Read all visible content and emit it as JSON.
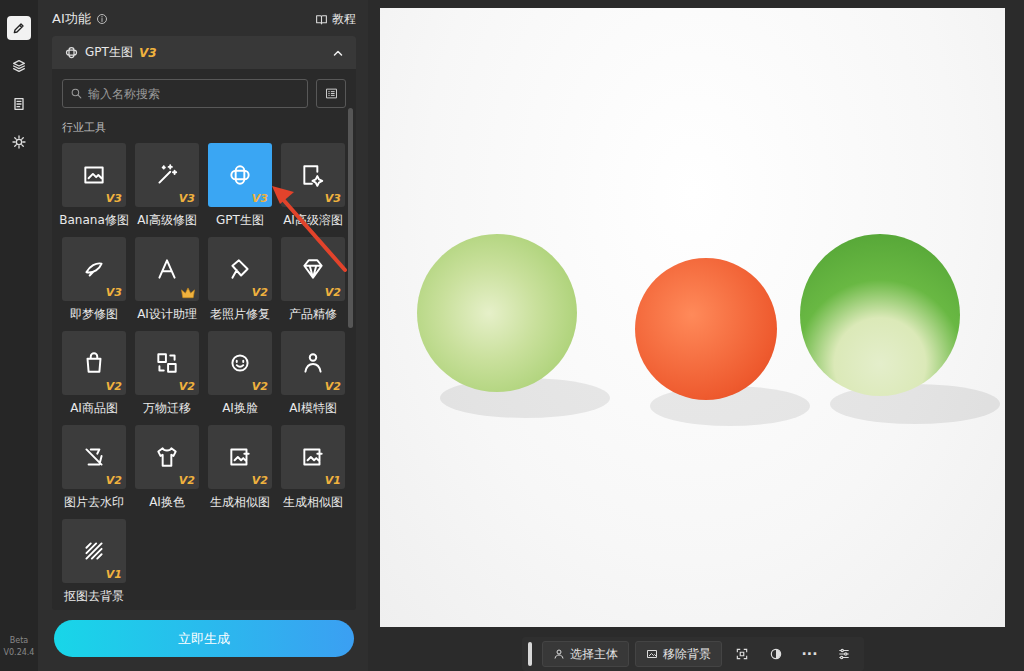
{
  "nav": [
    {
      "selected": true
    },
    {
      "selected": false
    },
    {
      "selected": false
    },
    {
      "selected": false
    }
  ],
  "version": {
    "label": "Beta",
    "number": "V0.24.4"
  },
  "panel": {
    "title": "AI功能",
    "tutorial": "教程"
  },
  "section": {
    "title": "GPT生图",
    "badge": "V3",
    "expanded": true
  },
  "search": {
    "placeholder": "输入名称搜索"
  },
  "group": "行业工具",
  "tools": [
    {
      "label": "Banana修图",
      "kind": "version",
      "badge": "V3",
      "selected": false
    },
    {
      "label": "AI高级修图",
      "kind": "version",
      "badge": "V3",
      "selected": false
    },
    {
      "label": "GPT生图",
      "kind": "version",
      "badge": "V3",
      "selected": true
    },
    {
      "label": "AI高级溶图",
      "kind": "version",
      "badge": "V3",
      "selected": false
    },
    {
      "label": "即梦修图",
      "kind": "version",
      "badge": "V3",
      "selected": false
    },
    {
      "label": "AI设计助理",
      "kind": "crown",
      "selected": false
    },
    {
      "label": "老照片修复",
      "kind": "version",
      "badge": "V2",
      "selected": false
    },
    {
      "label": "产品精修",
      "kind": "version",
      "badge": "V2",
      "selected": false
    },
    {
      "label": "AI商品图",
      "kind": "version",
      "badge": "V2",
      "selected": false
    },
    {
      "label": "万物迁移",
      "kind": "version",
      "badge": "V2",
      "selected": false
    },
    {
      "label": "AI换脸",
      "kind": "version",
      "badge": "V2",
      "selected": false
    },
    {
      "label": "AI模特图",
      "kind": "version",
      "badge": "V2",
      "selected": false
    },
    {
      "label": "图片去水印",
      "kind": "version",
      "badge": "V2",
      "selected": false
    },
    {
      "label": "AI换色",
      "kind": "version",
      "badge": "V2",
      "selected": false
    },
    {
      "label": "生成相似图",
      "kind": "version",
      "badge": "V2",
      "selected": false
    },
    {
      "label": "生成相似图",
      "kind": "version",
      "badge": "V1",
      "selected": false
    },
    {
      "label": "抠图去背景",
      "kind": "version",
      "badge": "V1",
      "selected": false
    }
  ],
  "generate_button": "立即生成",
  "toolbar": {
    "buttons": [
      {
        "label": "选择主体"
      },
      {
        "label": "移除背景"
      }
    ],
    "more": "···"
  }
}
